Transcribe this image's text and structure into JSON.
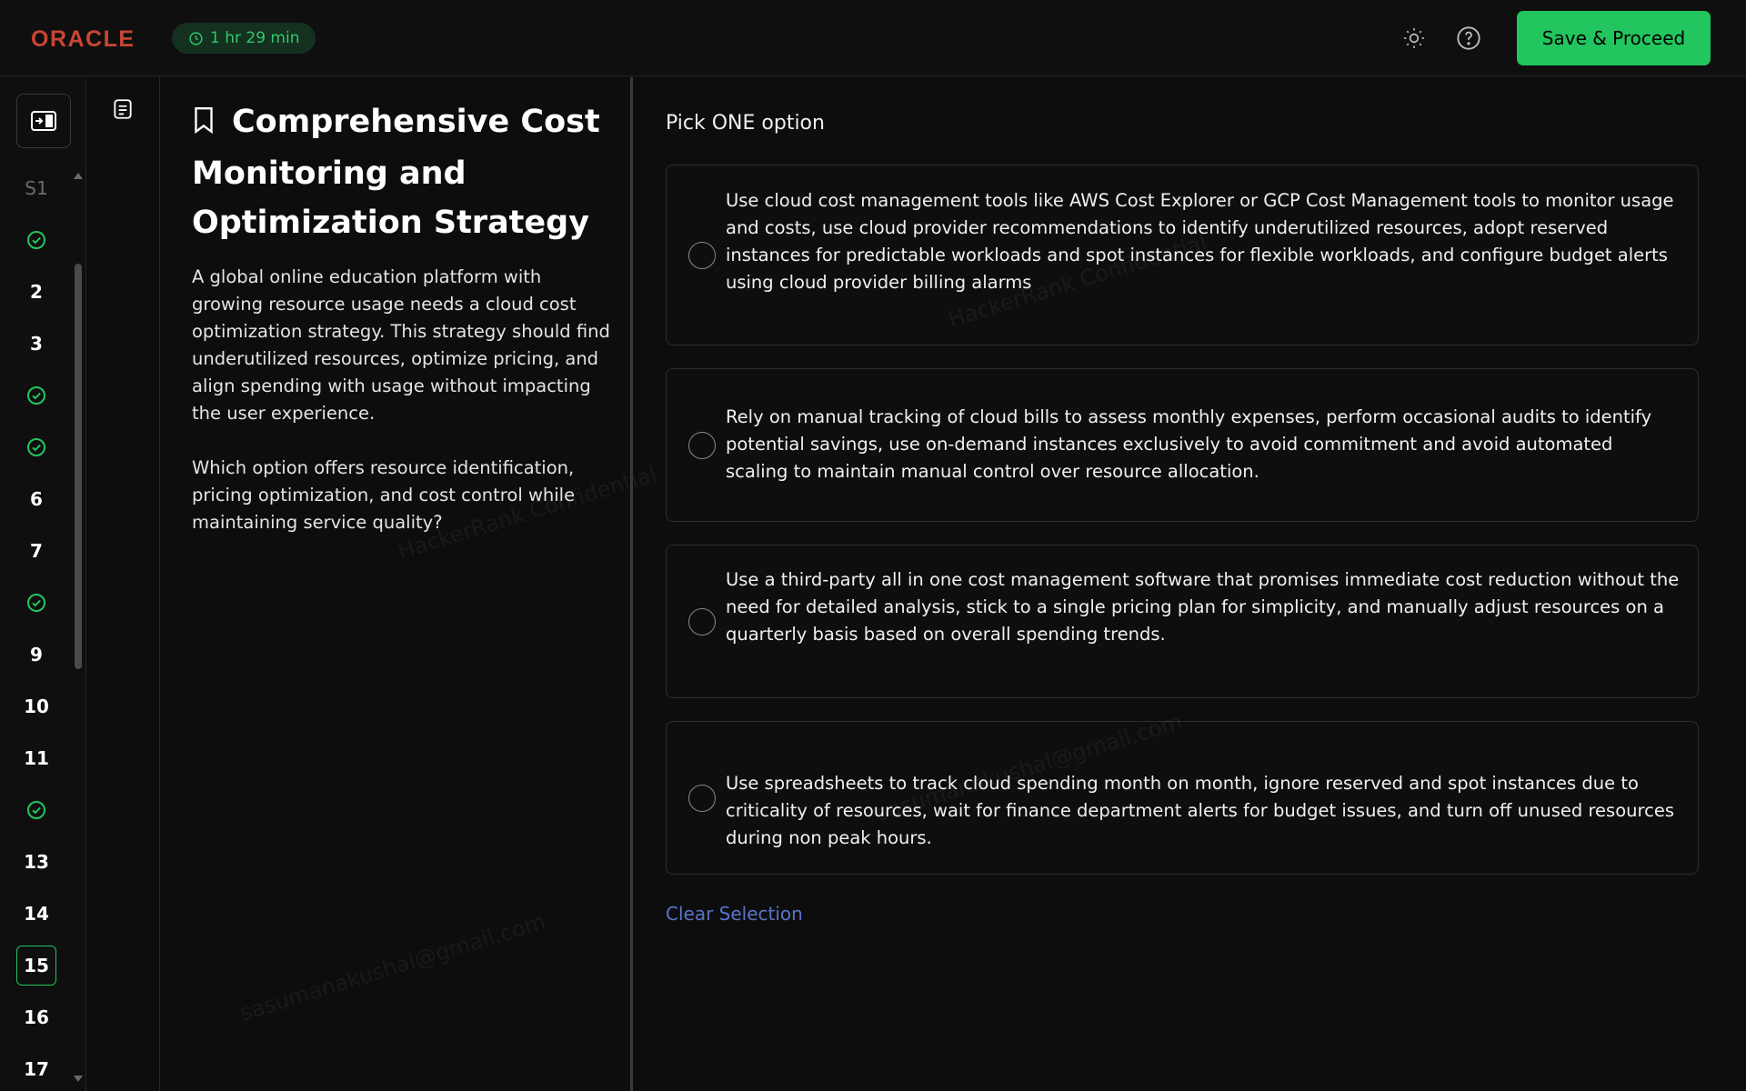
{
  "header": {
    "logo": "ORACLE",
    "timer": "1 hr 29 min",
    "save_label": "Save & Proceed"
  },
  "sidebar": {
    "questions": [
      {
        "label": "S1",
        "state": "section"
      },
      {
        "label": "",
        "state": "done"
      },
      {
        "label": "2",
        "state": "todo"
      },
      {
        "label": "3",
        "state": "todo"
      },
      {
        "label": "",
        "state": "done"
      },
      {
        "label": "",
        "state": "done"
      },
      {
        "label": "6",
        "state": "todo"
      },
      {
        "label": "7",
        "state": "todo"
      },
      {
        "label": "",
        "state": "done"
      },
      {
        "label": "9",
        "state": "todo"
      },
      {
        "label": "10",
        "state": "todo"
      },
      {
        "label": "11",
        "state": "todo"
      },
      {
        "label": "",
        "state": "done"
      },
      {
        "label": "13",
        "state": "todo"
      },
      {
        "label": "14",
        "state": "todo"
      },
      {
        "label": "15",
        "state": "current"
      },
      {
        "label": "16",
        "state": "todo"
      },
      {
        "label": "17",
        "state": "todo"
      }
    ]
  },
  "question": {
    "title": "Comprehensive Cost Monitoring and Optimization Strategy",
    "paragraph1": "A global online education platform with growing resource usage needs a cloud cost optimization strategy. This strategy should find underutilized resources, optimize pricing, and align spending with usage without impacting the user experience.",
    "paragraph2": "Which option offers resource identification, pricing optimization, and cost control while maintaining service quality?"
  },
  "answers": {
    "instruction": "Pick ONE option",
    "options": [
      {
        "text": "Use cloud cost management tools like AWS Cost Explorer or GCP Cost Management tools to monitor usage and costs, use cloud provider recommendations to identify underutilized resources, adopt reserved instances for predictable workloads and spot instances for flexible workloads, and configure budget alerts using cloud provider billing alarms"
      },
      {
        "text": "Rely on manual tracking of cloud bills to assess monthly expenses, perform occasional audits to identify potential savings, use on-demand instances exclusively to avoid commitment and avoid automated scaling to maintain manual control over resource allocation."
      },
      {
        "text": " Use a third-party all in one cost management software that promises immediate cost reduction without the need for detailed analysis, stick to a single pricing plan for simplicity, and manually adjust resources on a quarterly basis based on overall spending trends."
      },
      {
        "text": "Use spreadsheets to track cloud spending month on month, ignore reserved and spot instances due to criticality of resources, wait for finance department alerts for budget issues, and turn off unused resources during non peak hours."
      }
    ],
    "clear_label": "Clear Selection"
  },
  "watermarks": {
    "email": "sasumanakushal@gmail.com",
    "confidential": "HackerRank Confidential"
  },
  "colors": {
    "accent": "#22c55e",
    "brand": "#c74634",
    "link": "#5b74c9"
  }
}
